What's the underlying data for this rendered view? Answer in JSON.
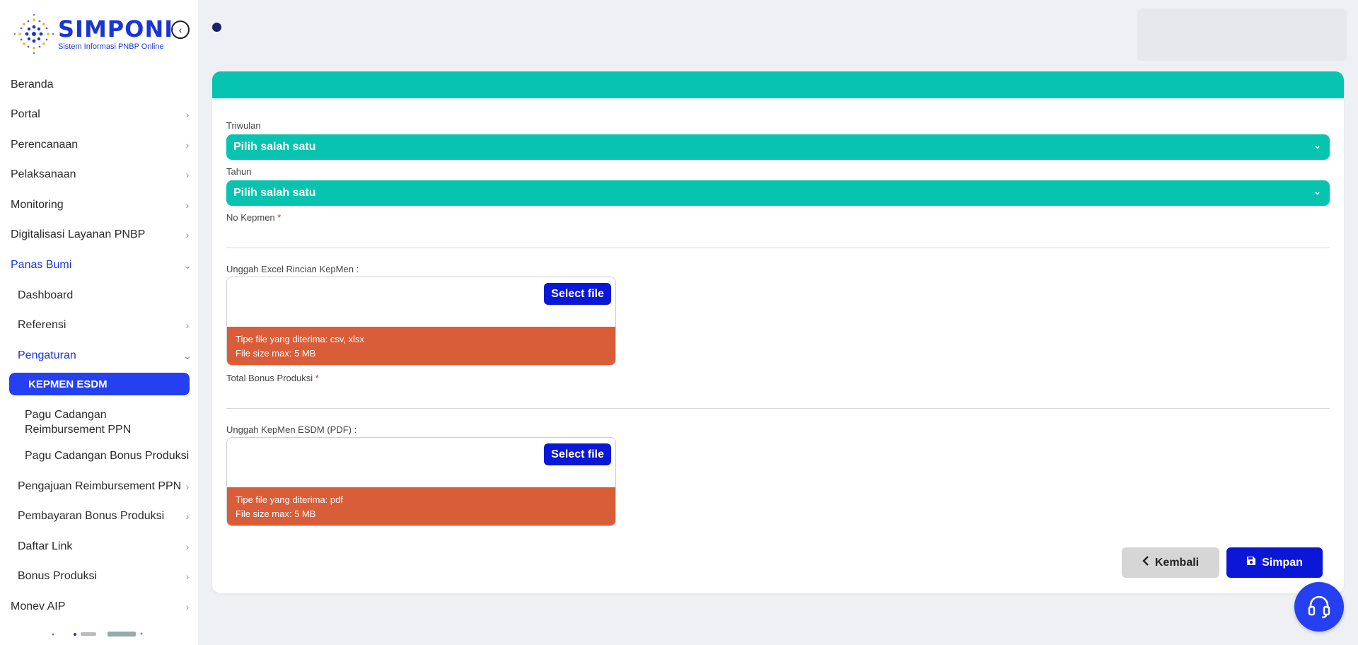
{
  "brand": {
    "title": "SIMPONI",
    "subtitle": "Sistem Informasi PNBP Online",
    "color": "#1a35d6"
  },
  "sidebar": {
    "items": [
      {
        "label": "Beranda",
        "chevron": "none"
      },
      {
        "label": "Portal",
        "chevron": "right"
      },
      {
        "label": "Perencanaan",
        "chevron": "right"
      },
      {
        "label": "Pelaksanaan",
        "chevron": "right"
      },
      {
        "label": "Monitoring",
        "chevron": "right"
      },
      {
        "label": "Digitalisasi Layanan PNBP",
        "chevron": "right"
      },
      {
        "label": "Panas Bumi",
        "chevron": "down"
      },
      {
        "label": "Dashboard",
        "chevron": "none"
      },
      {
        "label": "Referensi",
        "chevron": "right"
      },
      {
        "label": "Pengaturan",
        "chevron": "down"
      },
      {
        "label": "KEPMEN ESDM",
        "chevron": "none"
      },
      {
        "label": "Pagu Cadangan Reimbursement PPN",
        "chevron": "none"
      },
      {
        "label": "Pagu Cadangan Bonus Produksi",
        "chevron": "none"
      },
      {
        "label": "Pengajuan Reimbursement PPN",
        "chevron": "right"
      },
      {
        "label": "Pembayaran Bonus Produksi",
        "chevron": "right"
      },
      {
        "label": "Daftar Link",
        "chevron": "right"
      },
      {
        "label": "Bonus Produksi",
        "chevron": "right"
      },
      {
        "label": "Monev AIP",
        "chevron": "right"
      }
    ]
  },
  "form": {
    "triwulan": {
      "label": "Triwulan",
      "value": "Pilih salah satu"
    },
    "tahun": {
      "label": "Tahun",
      "value": "Pilih salah satu"
    },
    "no_kepmen": {
      "label": "No Kepmen",
      "required": "*",
      "value": ""
    },
    "upload_excel": {
      "label": "Unggah Excel Rincian KepMen :",
      "button": "Select file",
      "info_type": "Tipe file yang diterima: csv, xlsx",
      "info_size": "File size max: 5 MB"
    },
    "total_bonus": {
      "label": "Total Bonus Produksi",
      "required": "*",
      "value": ""
    },
    "upload_pdf": {
      "label": "Unggah KepMen ESDM (PDF) :",
      "button": "Select file",
      "info_type": "Tipe file yang diterima: pdf",
      "info_size": "File size max: 5 MB"
    }
  },
  "actions": {
    "back": "Kembali",
    "save": "Simpan"
  },
  "colors": {
    "teal": "#06c4b0",
    "primary": "#0a17d6",
    "active": "#2540f0",
    "warning": "#da5d3a"
  }
}
